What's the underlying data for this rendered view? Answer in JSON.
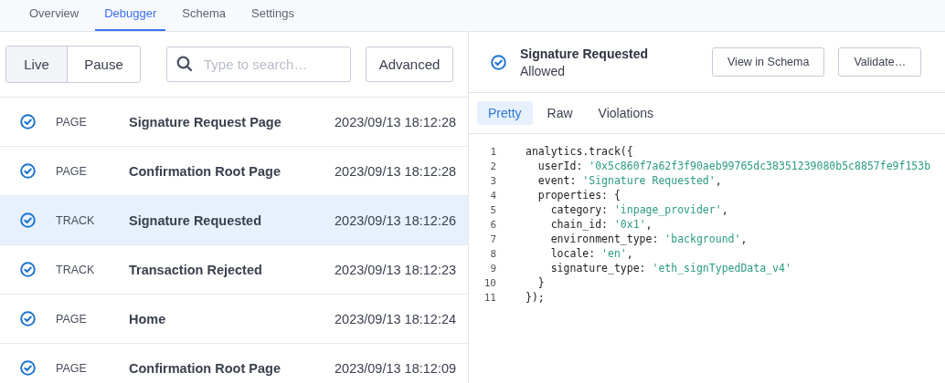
{
  "nav_tabs": [
    {
      "label": "Overview",
      "selected": false
    },
    {
      "label": "Debugger",
      "selected": true
    },
    {
      "label": "Schema",
      "selected": false
    },
    {
      "label": "Settings",
      "selected": false
    }
  ],
  "mode_toggle": [
    {
      "label": "Live",
      "selected": true
    },
    {
      "label": "Pause",
      "selected": false
    }
  ],
  "search": {
    "placeholder": "Type to search…"
  },
  "advanced_button": "Advanced",
  "events": [
    {
      "type": "PAGE",
      "name": "Signature Request Page",
      "time": "2023/09/13 18:12:28",
      "selected": false
    },
    {
      "type": "PAGE",
      "name": "Confirmation Root Page",
      "time": "2023/09/13 18:12:28",
      "selected": false
    },
    {
      "type": "TRACK",
      "name": "Signature Requested",
      "time": "2023/09/13 18:12:26",
      "selected": true
    },
    {
      "type": "TRACK",
      "name": "Transaction Rejected",
      "time": "2023/09/13 18:12:23",
      "selected": false
    },
    {
      "type": "PAGE",
      "name": "Home",
      "time": "2023/09/13 18:12:24",
      "selected": false
    },
    {
      "type": "PAGE",
      "name": "Confirmation Root Page",
      "time": "2023/09/13 18:12:09",
      "selected": false
    }
  ],
  "detail": {
    "title": "Signature Requested",
    "status": "Allowed",
    "buttons": [
      "View in Schema",
      "Validate…"
    ],
    "view_tabs": [
      {
        "label": "Pretty",
        "selected": true
      },
      {
        "label": "Raw",
        "selected": false
      },
      {
        "label": "Violations",
        "selected": false
      }
    ],
    "code_lines": [
      {
        "number": "1",
        "segments": [
          {
            "kind": "plain",
            "text": "analytics.track({"
          }
        ]
      },
      {
        "number": "2",
        "segments": [
          {
            "kind": "plain",
            "text": "  userId: "
          },
          {
            "kind": "string",
            "text": "'0x5c860f7a62f3f90aeb99765dc38351239080b5c8857fe9f153b"
          }
        ]
      },
      {
        "number": "3",
        "segments": [
          {
            "kind": "plain",
            "text": "  event: "
          },
          {
            "kind": "string",
            "text": "'Signature Requested'"
          },
          {
            "kind": "plain",
            "text": ","
          }
        ]
      },
      {
        "number": "4",
        "segments": [
          {
            "kind": "plain",
            "text": "  properties: {"
          }
        ]
      },
      {
        "number": "5",
        "segments": [
          {
            "kind": "plain",
            "text": "    category: "
          },
          {
            "kind": "string",
            "text": "'inpage_provider'"
          },
          {
            "kind": "plain",
            "text": ","
          }
        ]
      },
      {
        "number": "6",
        "segments": [
          {
            "kind": "plain",
            "text": "    chain_id: "
          },
          {
            "kind": "string",
            "text": "'0x1'"
          },
          {
            "kind": "plain",
            "text": ","
          }
        ]
      },
      {
        "number": "7",
        "segments": [
          {
            "kind": "plain",
            "text": "    environment_type: "
          },
          {
            "kind": "string",
            "text": "'background'"
          },
          {
            "kind": "plain",
            "text": ","
          }
        ]
      },
      {
        "number": "8",
        "segments": [
          {
            "kind": "plain",
            "text": "    locale: "
          },
          {
            "kind": "string",
            "text": "'en'"
          },
          {
            "kind": "plain",
            "text": ","
          }
        ]
      },
      {
        "number": "9",
        "segments": [
          {
            "kind": "plain",
            "text": "    signature_type: "
          },
          {
            "kind": "string",
            "text": "'eth_signTypedData_v4'"
          }
        ]
      },
      {
        "number": "10",
        "segments": [
          {
            "kind": "plain",
            "text": "  }"
          }
        ]
      },
      {
        "number": "11",
        "segments": [
          {
            "kind": "plain",
            "text": "});"
          }
        ]
      }
    ]
  }
}
